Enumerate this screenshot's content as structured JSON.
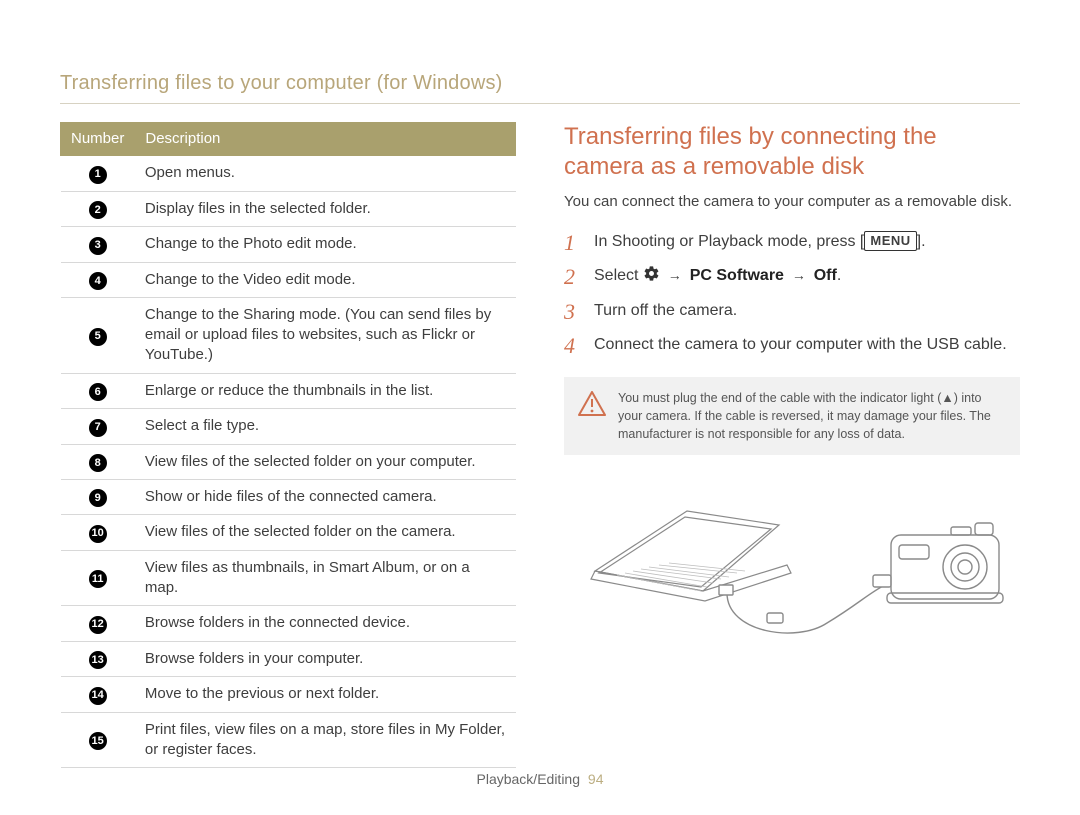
{
  "header": "Transferring files to your computer (for Windows)",
  "table": {
    "headers": {
      "num": "Number",
      "desc": "Description"
    },
    "rows": [
      {
        "n": "1",
        "d": "Open menus."
      },
      {
        "n": "2",
        "d": "Display files in the selected folder."
      },
      {
        "n": "3",
        "d": "Change to the Photo edit mode."
      },
      {
        "n": "4",
        "d": "Change to the Video edit mode."
      },
      {
        "n": "5",
        "d": "Change to the Sharing mode. (You can send files by email or upload files to websites, such as Flickr or YouTube.)"
      },
      {
        "n": "6",
        "d": "Enlarge or reduce the thumbnails in the list."
      },
      {
        "n": "7",
        "d": "Select a file type."
      },
      {
        "n": "8",
        "d": "View files of the selected folder on your computer."
      },
      {
        "n": "9",
        "d": "Show or hide files of the connected camera."
      },
      {
        "n": "10",
        "d": "View files of the selected folder on the camera."
      },
      {
        "n": "11",
        "d": "View files as thumbnails, in Smart Album, or on a map."
      },
      {
        "n": "12",
        "d": "Browse folders in the connected device."
      },
      {
        "n": "13",
        "d": "Browse folders in your computer."
      },
      {
        "n": "14",
        "d": "Move to the previous or next folder."
      },
      {
        "n": "15",
        "d": "Print files, view files on a map, store files in My Folder, or register faces."
      }
    ]
  },
  "section": {
    "title": "Transferring files by connecting the camera as a removable disk",
    "intro": "You can connect the camera to your computer as a removable disk.",
    "steps": [
      {
        "n": "1",
        "pre": "In Shooting or Playback mode, press [",
        "badge": "MENU",
        "post": "]."
      },
      {
        "n": "2",
        "pre": "Select ",
        "gear": true,
        "arrow1": " → ",
        "b1": "PC Software",
        "arrow2": " → ",
        "b2": "Off",
        "post": "."
      },
      {
        "n": "3",
        "text": "Turn off the camera."
      },
      {
        "n": "4",
        "text": "Connect the camera to your computer with the USB cable."
      }
    ],
    "caution": "You must plug the end of the cable with the indicator light (▲) into your camera. If the cable is reversed, it may damage your files. The manufacturer is not responsible for any loss of data."
  },
  "footer": {
    "section": "Playback/Editing",
    "page": "94"
  }
}
